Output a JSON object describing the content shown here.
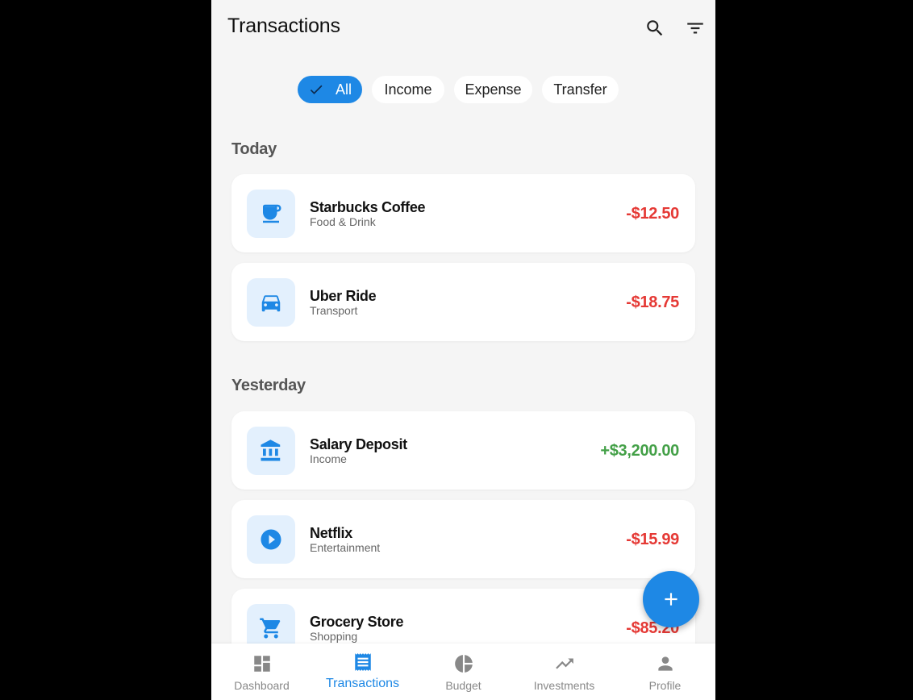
{
  "header": {
    "title": "Transactions"
  },
  "filters": [
    "All",
    "Income",
    "Expense",
    "Transfer"
  ],
  "sections": [
    {
      "title": "Today",
      "items": [
        {
          "name": "Starbucks Coffee",
          "category": "Food & Drink",
          "amount": "-$12.50",
          "icon": "coffee-icon"
        },
        {
          "name": "Uber Ride",
          "category": "Transport",
          "amount": "-$18.75",
          "icon": "car-icon"
        }
      ]
    },
    {
      "title": "Yesterday",
      "items": [
        {
          "name": "Salary Deposit",
          "category": "Income",
          "amount": "+$3,200.00",
          "icon": "bank-icon"
        },
        {
          "name": "Netflix",
          "category": "Entertainment",
          "amount": "-$15.99",
          "icon": "play-circle-icon"
        },
        {
          "name": "Grocery Store",
          "category": "Shopping",
          "amount": "-$85.20",
          "icon": "cart-icon"
        }
      ]
    }
  ],
  "nav": [
    {
      "label": "Dashboard",
      "icon": "dashboard-icon"
    },
    {
      "label": "Transactions",
      "icon": "receipt-icon"
    },
    {
      "label": "Budget",
      "icon": "pie-chart-icon"
    },
    {
      "label": "Investments",
      "icon": "trending-up-icon"
    },
    {
      "label": "Profile",
      "icon": "person-icon"
    }
  ],
  "colors": {
    "accent": "#1e88e5",
    "expense": "#e53935",
    "income": "#43a047",
    "background": "#f5f5f5"
  }
}
